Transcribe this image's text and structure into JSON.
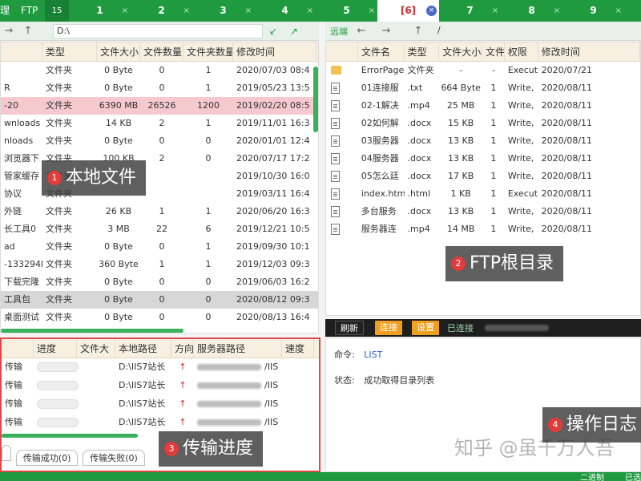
{
  "tabs": {
    "app_labels": [
      "理",
      "FTP"
    ],
    "first_tab": "15",
    "numbered": [
      {
        "label": "1",
        "close": "×"
      },
      {
        "label": "2",
        "close": "×"
      },
      {
        "label": "3",
        "close": "×"
      },
      {
        "label": "4",
        "close": "×"
      },
      {
        "label": "5",
        "close": "×"
      },
      {
        "label": "[6]",
        "close": "×",
        "active": true
      },
      {
        "label": "7",
        "close": "×"
      },
      {
        "label": "8",
        "close": "×"
      },
      {
        "label": "9",
        "close": "×"
      }
    ]
  },
  "local": {
    "path": "D:\\",
    "columns": [
      "类型",
      "文件大小",
      "文件数量",
      "文件夹数量",
      "修改时间"
    ],
    "rows": [
      {
        "name": "",
        "type": "文件夹",
        "size": "0 Byte",
        "files": "0",
        "folders": "1",
        "time": "2020/07/03 08:4"
      },
      {
        "name": "R",
        "type": "文件夹",
        "size": "0 Byte",
        "files": "0",
        "folders": "1",
        "time": "2019/05/23 13:5"
      },
      {
        "name": "-20",
        "type": "文件夹",
        "size": "6390 MB",
        "files": "26526",
        "folders": "1200",
        "time": "2019/02/20 08:5"
      },
      {
        "name": "wnloads",
        "type": "文件夹",
        "size": "14 KB",
        "files": "2",
        "folders": "1",
        "time": "2019/11/01 16:3"
      },
      {
        "name": "nloads",
        "type": "文件夹",
        "size": "0 Byte",
        "files": "0",
        "folders": "0",
        "time": "2020/01/01 12:4"
      },
      {
        "name": "浏览器下",
        "type": "文件夹",
        "size": "100 KB",
        "files": "2",
        "folders": "0",
        "time": "2020/07/17 17:2"
      },
      {
        "name": "管家缓存",
        "type": "文件夹",
        "size": "",
        "files": "",
        "folders": "",
        "time": "2019/10/30 16:0"
      },
      {
        "name": "协议",
        "type": "文件夹",
        "size": "",
        "files": "",
        "folders": "",
        "time": "2019/03/11 16:4"
      },
      {
        "name": "外链",
        "type": "文件夹",
        "size": "26 KB",
        "files": "1",
        "folders": "1",
        "time": "2020/06/20 16:3"
      },
      {
        "name": "长工具0",
        "type": "文件夹",
        "size": "3 MB",
        "files": "22",
        "folders": "6",
        "time": "2019/12/21 10:5"
      },
      {
        "name": "ad",
        "type": "文件夹",
        "size": "0 Byte",
        "files": "0",
        "folders": "1",
        "time": "2019/09/30 10:1"
      },
      {
        "name": "-133294b",
        "type": "文件夹",
        "size": "360 Byte",
        "files": "1",
        "folders": "1",
        "time": "2019/12/03 09:3"
      },
      {
        "name": "下载完隆",
        "type": "文件夹",
        "size": "0 Byte",
        "files": "0",
        "folders": "0",
        "time": "2019/06/03 16:2"
      },
      {
        "name": "工具包",
        "type": "文件夹",
        "size": "0 Byte",
        "files": "0",
        "folders": "0",
        "time": "2020/08/12 09:3"
      },
      {
        "name": "桌面测试",
        "type": "文件夹",
        "size": "0 Byte",
        "files": "0",
        "folders": "0",
        "time": "2020/08/13 16:4"
      }
    ]
  },
  "remote": {
    "label": "远端",
    "path": "/",
    "columns": [
      "文件名",
      "类型",
      "文件大小",
      "文件",
      "权限",
      "修改时间"
    ],
    "rows": [
      {
        "name": "ErrorPage",
        "type": "文件夹",
        "size": "-",
        "files": "-",
        "perm": "Execut",
        "time": "2020/07/21"
      },
      {
        "name": "01连接服",
        "type": ".txt",
        "size": "664 Byte",
        "files": "1",
        "perm": "Write,",
        "time": "2020/08/11"
      },
      {
        "name": "02-1解决",
        "type": ".mp4",
        "size": "25 MB",
        "files": "1",
        "perm": "Write,",
        "time": "2020/08/11"
      },
      {
        "name": "02如何解",
        "type": ".docx",
        "size": "15 KB",
        "files": "1",
        "perm": "Write,",
        "time": "2020/08/11"
      },
      {
        "name": "03服务器",
        "type": ".docx",
        "size": "13 KB",
        "files": "1",
        "perm": "Write,",
        "time": "2020/08/11"
      },
      {
        "name": "04服务器",
        "type": ".docx",
        "size": "13 KB",
        "files": "1",
        "perm": "Write,",
        "time": "2020/08/11"
      },
      {
        "name": "05怎么廷",
        "type": ".docx",
        "size": "17 KB",
        "files": "1",
        "perm": "Write,",
        "time": "2020/08/11"
      },
      {
        "name": "index.htm",
        "type": ".html",
        "size": "1 KB",
        "files": "1",
        "perm": "Execut",
        "time": "2020/08/11"
      },
      {
        "name": "多台服务",
        "type": ".docx",
        "size": "13 KB",
        "files": "1",
        "perm": "Write,",
        "time": "2020/08/11"
      },
      {
        "name": "服务器连",
        "type": ".mp4",
        "size": "14 MB",
        "files": "1",
        "perm": "Write,",
        "time": "2020/08/11"
      }
    ]
  },
  "transfer": {
    "columns": [
      "进度",
      "文件大",
      "本地路径",
      "方向",
      "服务器路径",
      "速度"
    ],
    "rows": [
      {
        "status": "传输",
        "local": "D:\\IIS7站长",
        "dir": "↑",
        "server": "/IIS"
      },
      {
        "status": "传输",
        "local": "D:\\IIS7站长",
        "dir": "↑",
        "server": "/IIS"
      },
      {
        "status": "传输",
        "local": "D:\\IIS7站长",
        "dir": "↑",
        "server": "/IIS"
      },
      {
        "status": "传输",
        "local": "D:\\IIS7站长",
        "dir": "↑",
        "server": "/IIS"
      }
    ],
    "subtabs": [
      "",
      "传输成功(0)",
      "传输失败(0)"
    ]
  },
  "log": {
    "buttons": [
      "刷新",
      "连接",
      "设置"
    ],
    "status_text": "已连接",
    "command_label": "命令:",
    "command_value": "LIST",
    "state_label": "状态:",
    "state_value": "成功取得目录列表"
  },
  "statusbar": {
    "items": [
      "二进制",
      "已选"
    ]
  },
  "callouts": [
    {
      "num": "1",
      "text": "本地文件"
    },
    {
      "num": "2",
      "text": "FTP根目录"
    },
    {
      "num": "3",
      "text": "传输进度"
    },
    {
      "num": "4",
      "text": "操作日志"
    }
  ],
  "watermark": "知乎 @虽千万人吾",
  "colors": {
    "accent": "#1f9a3f",
    "highlight": "#f6c9cf",
    "callout_dot": "#e23b3b"
  }
}
